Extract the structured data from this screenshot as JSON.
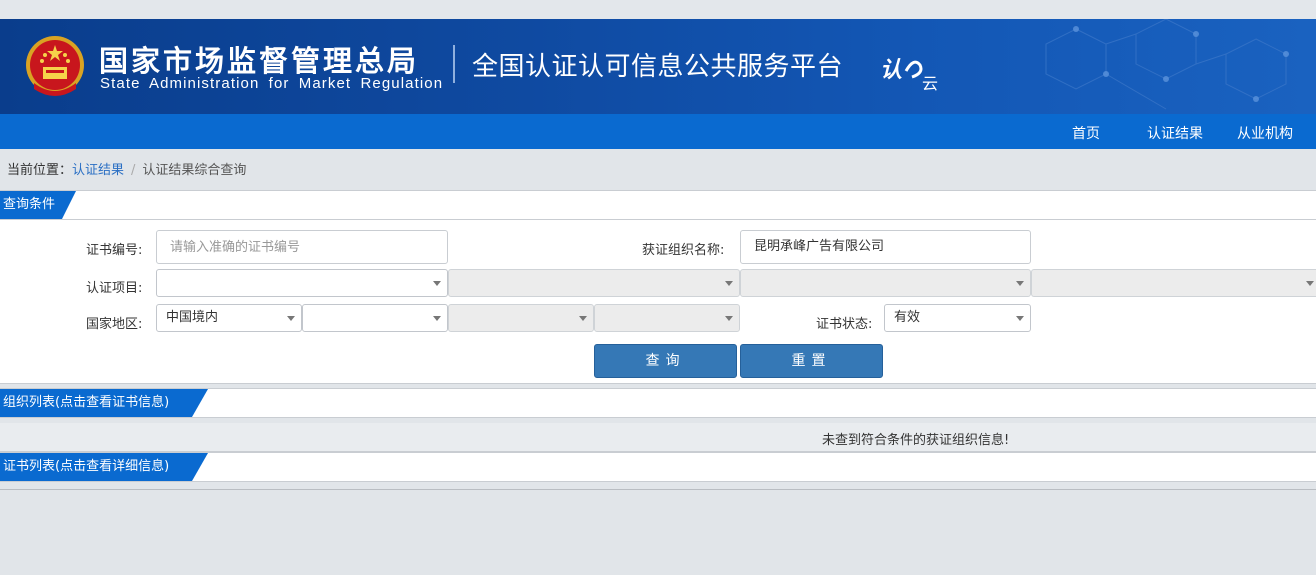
{
  "header": {
    "org_name_cn": "国家市场监督管理总局",
    "org_name_en": "State Administration for Market Regulation",
    "platform_title": "全国认证认可信息公共服务平台",
    "logo_text": "认e云"
  },
  "nav": {
    "items": [
      "首页",
      "认证结果",
      "从业机构"
    ]
  },
  "breadcrumb": {
    "prefix": "当前位置：",
    "link": "认证结果",
    "separator": "/",
    "current": "认证结果综合查询"
  },
  "query_panel": {
    "title": "查询条件",
    "cert_no_label": "证书编号:",
    "cert_no_placeholder": "请输入准确的证书编号",
    "org_name_label": "获证组织名称:",
    "org_name_value": "昆明承峰广告有限公司",
    "cert_project_label": "认证项目:",
    "cert_project_values": [
      "",
      "",
      "",
      ""
    ],
    "region_label": "国家地区:",
    "region_values": [
      "中国境内",
      "",
      "",
      ""
    ],
    "status_label": "证书状态:",
    "status_value": "有效",
    "search_button": "查询",
    "reset_button": "重置"
  },
  "org_list": {
    "title": "组织列表(点击查看证书信息)",
    "empty_message": "未查到符合条件的获证组织信息!"
  },
  "cert_list": {
    "title": "证书列表(点击查看详细信息)"
  },
  "colors": {
    "banner_blue": "#0f4aa1",
    "nav_blue": "#0a6ad0",
    "tab_blue": "#0a6ad0",
    "button_blue": "#3578b6"
  }
}
